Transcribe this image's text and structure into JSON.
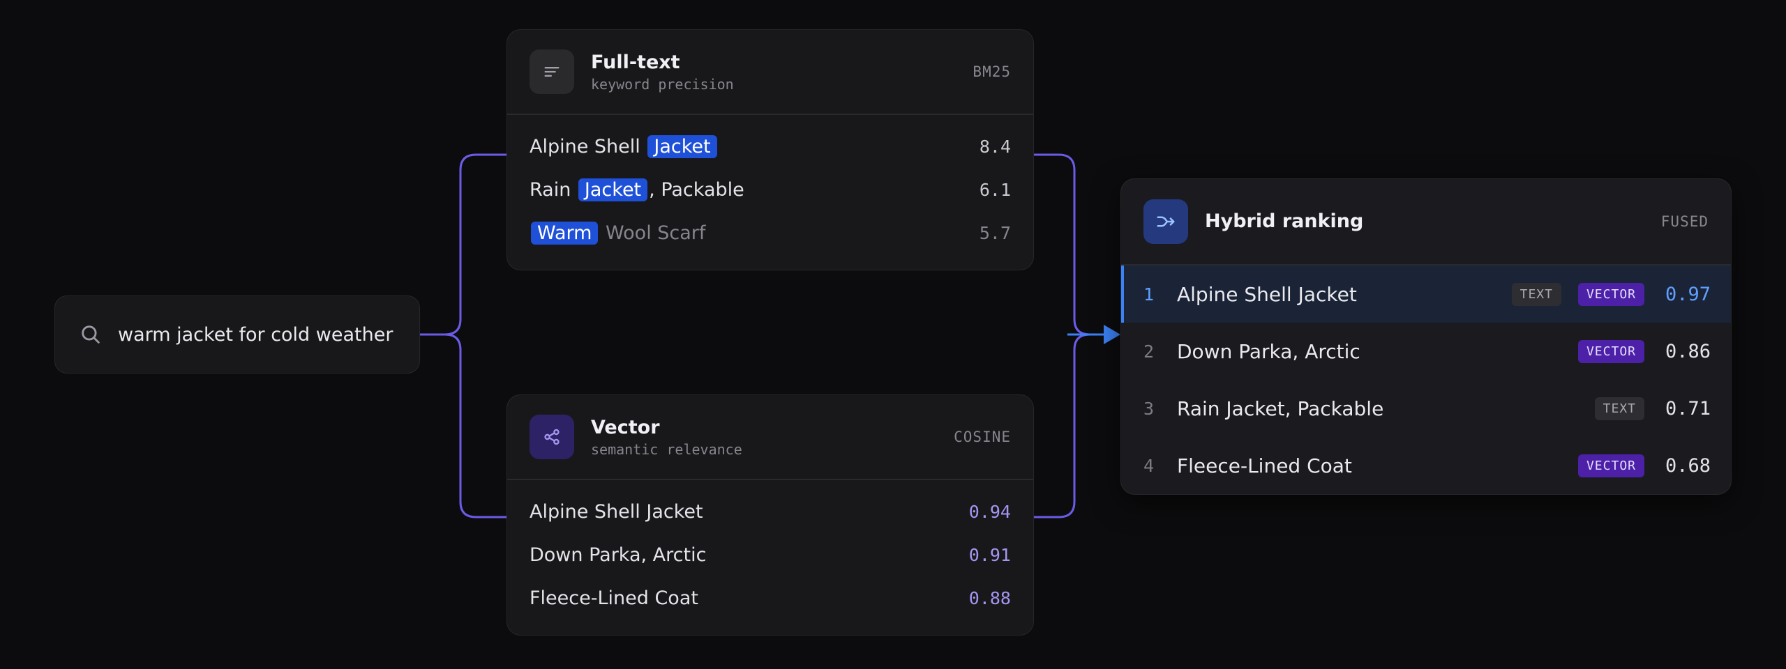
{
  "query": {
    "text": "warm jacket for cold weather"
  },
  "fulltext": {
    "title": "Full-text",
    "subtitle": "keyword precision",
    "tag": "BM25",
    "rows": [
      {
        "pre": "Alpine Shell ",
        "hl": "Jacket",
        "post": "",
        "score": "8.4"
      },
      {
        "pre": "Rain ",
        "hl": "Jacket",
        "post": ", Packable",
        "score": "6.1"
      },
      {
        "pre": "",
        "hl": "Warm",
        "post": " Wool Scarf",
        "score": "5.7"
      }
    ]
  },
  "vector": {
    "title": "Vector",
    "subtitle": "semantic relevance",
    "tag": "COSINE",
    "rows": [
      {
        "name": "Alpine Shell Jacket",
        "score": "0.94"
      },
      {
        "name": "Down Parka, Arctic",
        "score": "0.91"
      },
      {
        "name": "Fleece-Lined Coat",
        "score": "0.88"
      }
    ]
  },
  "hybrid": {
    "title": "Hybrid ranking",
    "tag": "FUSED",
    "rows": [
      {
        "rank": "1",
        "name": "Alpine Shell Jacket",
        "badge_text": "TEXT",
        "badge_vector": "VECTOR",
        "score": "0.97"
      },
      {
        "rank": "2",
        "name": "Down Parka, Arctic",
        "badge_vector": "VECTOR",
        "score": "0.86"
      },
      {
        "rank": "3",
        "name": "Rain Jacket, Packable",
        "badge_text": "TEXT",
        "score": "0.71"
      },
      {
        "rank": "4",
        "name": "Fleece-Lined Coat",
        "badge_vector": "VECTOR",
        "score": "0.68"
      }
    ]
  },
  "colors": {
    "connector": "#6b5ce7",
    "arrow": "#3b82f6",
    "highlight": "#1f50d8",
    "vector_badge": "#4c21a8"
  },
  "icons": {
    "query": "search-icon",
    "fulltext": "text-lines-icon",
    "vector": "share-nodes-icon",
    "hybrid": "merge-arrow-icon"
  }
}
